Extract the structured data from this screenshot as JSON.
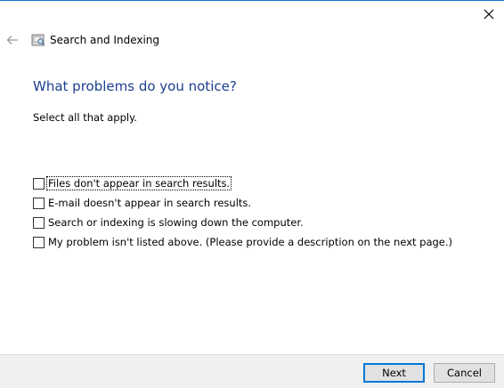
{
  "window": {
    "title": "Search and Indexing"
  },
  "icons": {
    "back": "arrow-left-icon",
    "app": "search-indexing-icon",
    "close": "close-icon"
  },
  "page": {
    "heading": "What problems do you notice?",
    "instruction": "Select all that apply."
  },
  "options": [
    {
      "label": "Files don't appear in search results.",
      "checked": false,
      "focused": true
    },
    {
      "label": "E-mail doesn't appear in search results.",
      "checked": false,
      "focused": false
    },
    {
      "label": "Search or indexing is slowing down the computer.",
      "checked": false,
      "focused": false
    },
    {
      "label": "My problem isn't listed above. (Please provide a description on the next page.)",
      "checked": false,
      "focused": false
    }
  ],
  "footer": {
    "next_label": "Next",
    "cancel_label": "Cancel"
  },
  "colors": {
    "accent": "#0078d7",
    "heading": "#1d3f8f",
    "window_border": "#1979ca",
    "footer_bg": "#f0f0f0"
  }
}
